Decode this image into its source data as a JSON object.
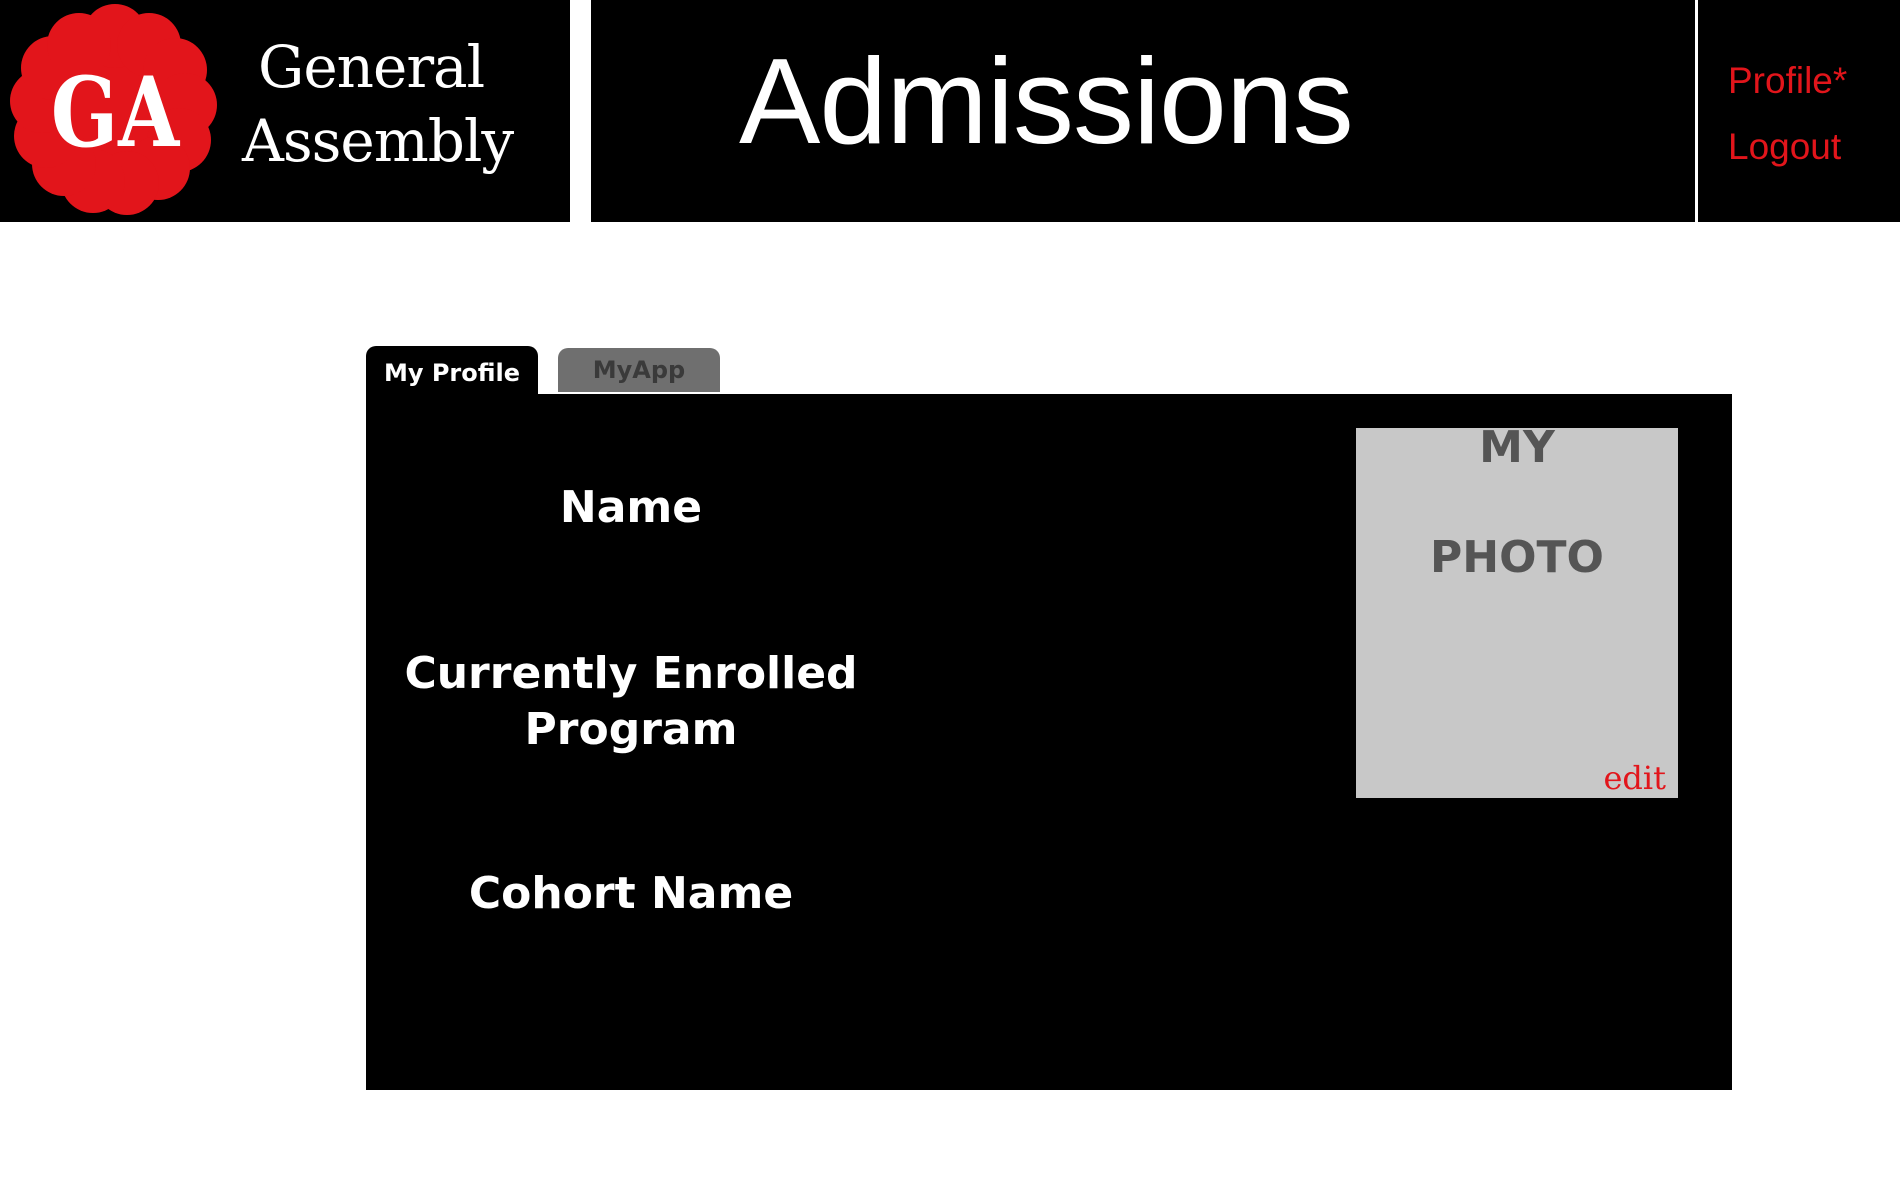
{
  "header": {
    "logo": {
      "initials": "GA",
      "brand_line_1": "General",
      "brand_line_2": "Assembly",
      "flower_color": "#e2151b"
    },
    "title": "Admissions",
    "nav": {
      "profile_label": "Profile*",
      "logout_label": "Logout",
      "link_color": "#e2151b"
    }
  },
  "tabs": [
    {
      "label": "My Profile",
      "active": true
    },
    {
      "label": "MyApp",
      "active": false
    }
  ],
  "profile": {
    "fields": [
      {
        "label_line_1": "Name"
      },
      {
        "label_line_1": "Currently Enrolled",
        "label_line_2": "Program"
      },
      {
        "label_line_1": "Cohort Name"
      }
    ],
    "photo": {
      "line_1": "MY",
      "line_2": "PHOTO",
      "edit_label": "edit"
    }
  },
  "colors": {
    "background": "#ffffff",
    "panel": "#000000",
    "accent": "#e2151b",
    "photo_placeholder": "#c8c8c8",
    "inactive_tab": "#6f6f6f"
  }
}
